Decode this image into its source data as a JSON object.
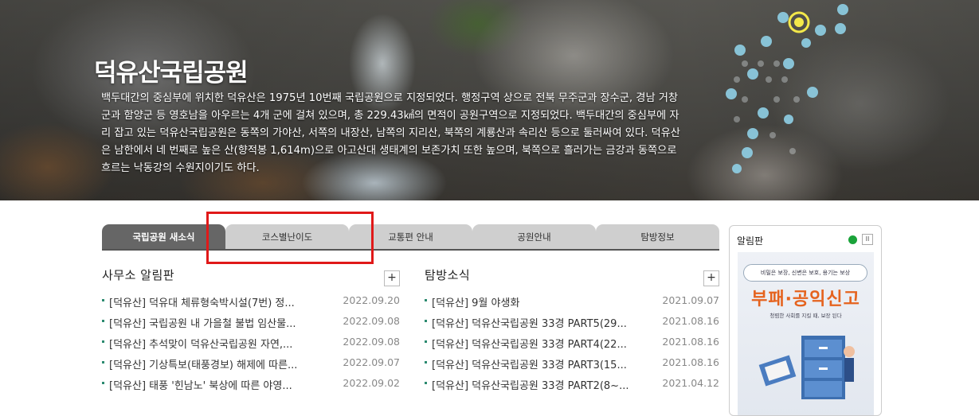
{
  "hero": {
    "title": "덕유산국립공원",
    "description": "백두대간의 중심부에 위치한 덕유산은 1975년 10번째 국립공원으로 지정되었다. 행정구역 상으로 전북 무주군과 장수군, 경남 거창군과 함양군 등 영호남을 아우르는 4개 군에 걸쳐 있으며, 총 229.43㎢의 면적이 공원구역으로 지정되었다. 백두대간의 중심부에 자리 잡고 있는 덕유산국립공원은 동쪽의 가야산, 서쪽의 내장산, 남쪽의 지리산, 북쪽의 계룡산과 속리산 등으로 둘러싸여 있다. 덕유산은 남한에서 네 번째로 높은 산(향적봉 1,614m)으로 아고산대 생태계의 보존가치 또한 높으며, 북쪽으로 흘러가는 금강과 동쪽으로 흐르는 낙동강의 수원지이기도 하다."
  },
  "tabs": [
    {
      "label": "국립공원 새소식",
      "active": true
    },
    {
      "label": "코스별난이도",
      "active": false
    },
    {
      "label": "교통편 안내",
      "active": false
    },
    {
      "label": "공원안내",
      "active": false
    },
    {
      "label": "탐방정보",
      "active": false
    }
  ],
  "office_board": {
    "title": "사무소 알림판",
    "more_label": "+",
    "items": [
      {
        "title": "[덕유산] 덕유대 체류형숙박시설(7번) 정...",
        "date": "2022.09.20"
      },
      {
        "title": "[덕유산] 국립공원 내 가을철 불법 임산물...",
        "date": "2022.09.08"
      },
      {
        "title": "[덕유산] 추석맞이 덕유산국립공원 자연,...",
        "date": "2022.09.08"
      },
      {
        "title": "[덕유산] 기상특보(태풍경보) 해제에 따른...",
        "date": "2022.09.07"
      },
      {
        "title": "[덕유산] 태풍 '힌남노' 북상에 따른 야영...",
        "date": "2022.09.02"
      }
    ]
  },
  "visit_news": {
    "title": "탐방소식",
    "more_label": "+",
    "items": [
      {
        "title": "[덕유산] 9월 야생화",
        "date": "2021.09.07"
      },
      {
        "title": "[덕유산] 덕유산국립공원 33경 PART5(29...",
        "date": "2021.08.16"
      },
      {
        "title": "[덕유산] 덕유산국립공원 33경 PART4(22...",
        "date": "2021.08.16"
      },
      {
        "title": "[덕유산] 덕유산국립공원 33경 PART3(15...",
        "date": "2021.08.16"
      },
      {
        "title": "[덕유산] 덕유산국립공원 33경 PART2(8~...",
        "date": "2021.04.12"
      }
    ]
  },
  "notice_panel": {
    "title": "알림판",
    "pause_label": "II",
    "banner": {
      "top": "비밀은 보장, 신변은 보호, 용기는 보상",
      "big": "부패·공익신고",
      "sub": "청렴한 사회를 지킬 때, 보장 된다"
    }
  },
  "colors": {
    "tab_active": "#666666",
    "tab_inactive": "#cfcfcf",
    "highlight": "#e01919",
    "bullet": "#2b8a6f",
    "banner_title": "#e5631e",
    "play": "#1aa33a"
  }
}
